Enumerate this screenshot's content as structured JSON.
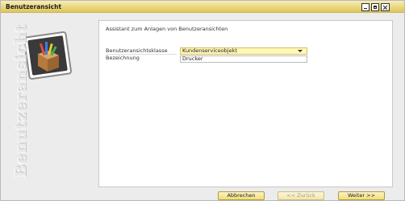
{
  "window": {
    "title": "Benutzeransicht",
    "side_label": "Benutzeransicht"
  },
  "panel": {
    "title": "Assistant zum Anlagen von Benutzeransichten"
  },
  "form": {
    "class_label": "Benutzeransichtsklasse",
    "class_value": "Kundenserviceobjekt",
    "name_label": "Bezeichnung",
    "name_value": "Drucker"
  },
  "buttons": {
    "cancel": "Abbrechen",
    "back": "<< Zurück",
    "next": "Weiter >>"
  },
  "colors": {
    "titlebar": "#e9d67a",
    "field_highlight": "#fff7b8"
  }
}
